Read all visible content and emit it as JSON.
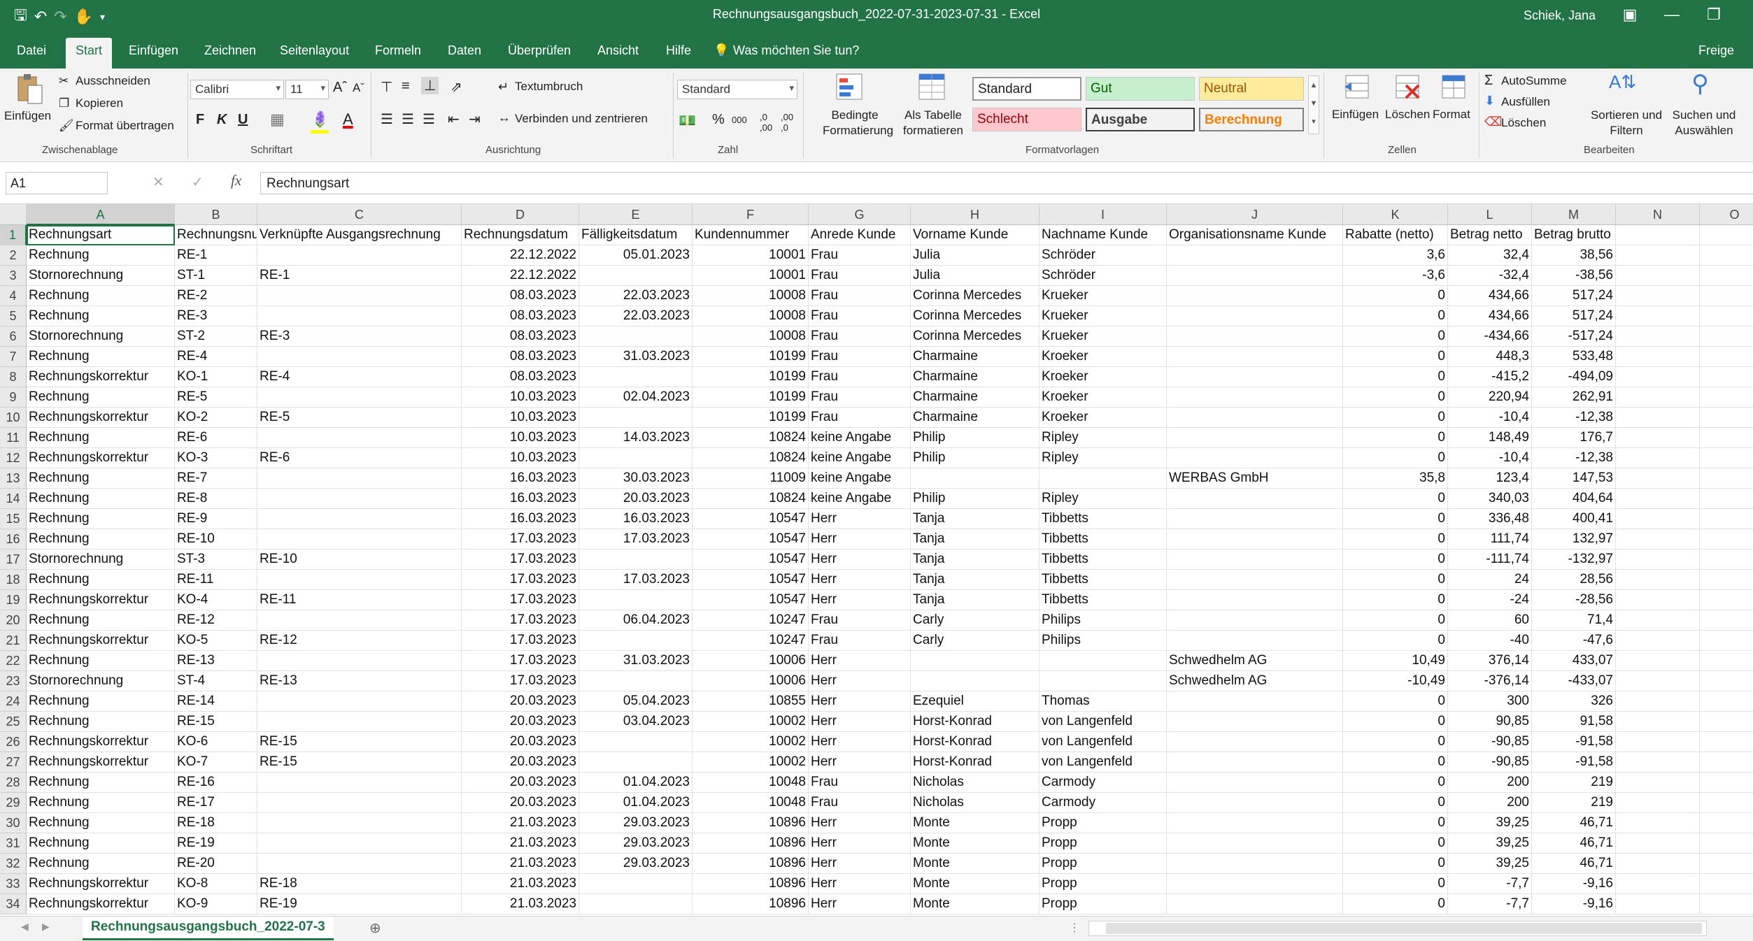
{
  "window": {
    "title": "Rechnungsausgangsbuch_2022-07-31-2023-07-31  -  Excel",
    "user": "Schiek, Jana"
  },
  "tabs": [
    "Datei",
    "Start",
    "Einfügen",
    "Zeichnen",
    "Seitenlayout",
    "Formeln",
    "Daten",
    "Überprüfen",
    "Ansicht",
    "Hilfe"
  ],
  "tell_me": "Was möchten Sie tun?",
  "share": "Freige",
  "ribbon": {
    "clipboard": {
      "paste": "Einfügen",
      "cut": "Ausschneiden",
      "copy": "Kopieren",
      "format_painter": "Format übertragen",
      "label": "Zwischenablage"
    },
    "font": {
      "name": "Calibri",
      "size": "11",
      "label": "Schriftart",
      "bold": "F",
      "italic": "K",
      "underline": "U"
    },
    "alignment": {
      "wrap": "Textumbruch",
      "merge": "Verbinden und zentrieren",
      "label": "Ausrichtung"
    },
    "number": {
      "format": "Standard",
      "label": "Zahl"
    },
    "styles": {
      "conditional": "Bedingte Formatierung",
      "as_table": "Als Tabelle formatieren",
      "standard": "Standard",
      "gut": "Gut",
      "neutral": "Neutral",
      "schlecht": "Schlecht",
      "ausgabe": "Ausgabe",
      "berechnung": "Berechnung",
      "label": "Formatvorlagen"
    },
    "cells": {
      "insert": "Einfügen",
      "delete": "Löschen",
      "format": "Format",
      "label": "Zellen"
    },
    "editing": {
      "autosum": "AutoSumme",
      "fill": "Ausfüllen",
      "clear": "Löschen",
      "sort": "Sortieren und Filtern",
      "find": "Suchen und Auswählen",
      "label": "Bearbeiten"
    }
  },
  "formula_bar": {
    "name_box": "A1",
    "content": "Rechnungsart"
  },
  "columns": [
    "A",
    "B",
    "C",
    "D",
    "E",
    "F",
    "G",
    "H",
    "I",
    "J",
    "K",
    "L",
    "M",
    "N",
    "O"
  ],
  "header_row": [
    "Rechnungsart",
    "Rechnungsnu",
    "Verknüpfte Ausgangsrechnung",
    "Rechnungsdatum",
    "Fälligkeitsdatum",
    "Kundennummer",
    "Anrede Kunde",
    "Vorname Kunde",
    "Nachname Kunde",
    "Organisationsname Kunde",
    "Rabatte (netto)",
    "Betrag netto",
    "Betrag brutto",
    "",
    ""
  ],
  "rows": [
    [
      "Rechnung",
      "RE-1",
      "",
      "22.12.2022",
      "05.01.2023",
      "10001",
      "Frau",
      "Julia",
      "Schröder",
      "",
      "3,6",
      "32,4",
      "38,56"
    ],
    [
      "Stornorechnung",
      "ST-1",
      "RE-1",
      "22.12.2022",
      "",
      "10001",
      "Frau",
      "Julia",
      "Schröder",
      "",
      "-3,6",
      "-32,4",
      "-38,56"
    ],
    [
      "Rechnung",
      "RE-2",
      "",
      "08.03.2023",
      "22.03.2023",
      "10008",
      "Frau",
      "Corinna Mercedes",
      "Krueker",
      "",
      "0",
      "434,66",
      "517,24"
    ],
    [
      "Rechnung",
      "RE-3",
      "",
      "08.03.2023",
      "22.03.2023",
      "10008",
      "Frau",
      "Corinna Mercedes",
      "Krueker",
      "",
      "0",
      "434,66",
      "517,24"
    ],
    [
      "Stornorechnung",
      "ST-2",
      "RE-3",
      "08.03.2023",
      "",
      "10008",
      "Frau",
      "Corinna Mercedes",
      "Krueker",
      "",
      "0",
      "-434,66",
      "-517,24"
    ],
    [
      "Rechnung",
      "RE-4",
      "",
      "08.03.2023",
      "31.03.2023",
      "10199",
      "Frau",
      "Charmaine",
      "Kroeker",
      "",
      "0",
      "448,3",
      "533,48"
    ],
    [
      "Rechnungskorrektur",
      "KO-1",
      "RE-4",
      "08.03.2023",
      "",
      "10199",
      "Frau",
      "Charmaine",
      "Kroeker",
      "",
      "0",
      "-415,2",
      "-494,09"
    ],
    [
      "Rechnung",
      "RE-5",
      "",
      "10.03.2023",
      "02.04.2023",
      "10199",
      "Frau",
      "Charmaine",
      "Kroeker",
      "",
      "0",
      "220,94",
      "262,91"
    ],
    [
      "Rechnungskorrektur",
      "KO-2",
      "RE-5",
      "10.03.2023",
      "",
      "10199",
      "Frau",
      "Charmaine",
      "Kroeker",
      "",
      "0",
      "-10,4",
      "-12,38"
    ],
    [
      "Rechnung",
      "RE-6",
      "",
      "10.03.2023",
      "14.03.2023",
      "10824",
      "keine Angabe",
      "Philip",
      "Ripley",
      "",
      "0",
      "148,49",
      "176,7"
    ],
    [
      "Rechnungskorrektur",
      "KO-3",
      "RE-6",
      "10.03.2023",
      "",
      "10824",
      "keine Angabe",
      "Philip",
      "Ripley",
      "",
      "0",
      "-10,4",
      "-12,38"
    ],
    [
      "Rechnung",
      "RE-7",
      "",
      "16.03.2023",
      "30.03.2023",
      "11009",
      "keine Angabe",
      "",
      "",
      "WERBAS GmbH",
      "35,8",
      "123,4",
      "147,53"
    ],
    [
      "Rechnung",
      "RE-8",
      "",
      "16.03.2023",
      "20.03.2023",
      "10824",
      "keine Angabe",
      "Philip",
      "Ripley",
      "",
      "0",
      "340,03",
      "404,64"
    ],
    [
      "Rechnung",
      "RE-9",
      "",
      "16.03.2023",
      "16.03.2023",
      "10547",
      "Herr",
      "Tanja",
      "Tibbetts",
      "",
      "0",
      "336,48",
      "400,41"
    ],
    [
      "Rechnung",
      "RE-10",
      "",
      "17.03.2023",
      "17.03.2023",
      "10547",
      "Herr",
      "Tanja",
      "Tibbetts",
      "",
      "0",
      "111,74",
      "132,97"
    ],
    [
      "Stornorechnung",
      "ST-3",
      "RE-10",
      "17.03.2023",
      "",
      "10547",
      "Herr",
      "Tanja",
      "Tibbetts",
      "",
      "0",
      "-111,74",
      "-132,97"
    ],
    [
      "Rechnung",
      "RE-11",
      "",
      "17.03.2023",
      "17.03.2023",
      "10547",
      "Herr",
      "Tanja",
      "Tibbetts",
      "",
      "0",
      "24",
      "28,56"
    ],
    [
      "Rechnungskorrektur",
      "KO-4",
      "RE-11",
      "17.03.2023",
      "",
      "10547",
      "Herr",
      "Tanja",
      "Tibbetts",
      "",
      "0",
      "-24",
      "-28,56"
    ],
    [
      "Rechnung",
      "RE-12",
      "",
      "17.03.2023",
      "06.04.2023",
      "10247",
      "Frau",
      "Carly",
      "Philips",
      "",
      "0",
      "60",
      "71,4"
    ],
    [
      "Rechnungskorrektur",
      "KO-5",
      "RE-12",
      "17.03.2023",
      "",
      "10247",
      "Frau",
      "Carly",
      "Philips",
      "",
      "0",
      "-40",
      "-47,6"
    ],
    [
      "Rechnung",
      "RE-13",
      "",
      "17.03.2023",
      "31.03.2023",
      "10006",
      "Herr",
      "",
      "",
      "Schwedhelm AG",
      "10,49",
      "376,14",
      "433,07"
    ],
    [
      "Stornorechnung",
      "ST-4",
      "RE-13",
      "17.03.2023",
      "",
      "10006",
      "Herr",
      "",
      "",
      "Schwedhelm AG",
      "-10,49",
      "-376,14",
      "-433,07"
    ],
    [
      "Rechnung",
      "RE-14",
      "",
      "20.03.2023",
      "05.04.2023",
      "10855",
      "Herr",
      "Ezequiel",
      "Thomas",
      "",
      "0",
      "300",
      "326"
    ],
    [
      "Rechnung",
      "RE-15",
      "",
      "20.03.2023",
      "03.04.2023",
      "10002",
      "Herr",
      "Horst-Konrad",
      "von Langenfeld",
      "",
      "0",
      "90,85",
      "91,58"
    ],
    [
      "Rechnungskorrektur",
      "KO-6",
      "RE-15",
      "20.03.2023",
      "",
      "10002",
      "Herr",
      "Horst-Konrad",
      "von Langenfeld",
      "",
      "0",
      "-90,85",
      "-91,58"
    ],
    [
      "Rechnungskorrektur",
      "KO-7",
      "RE-15",
      "20.03.2023",
      "",
      "10002",
      "Herr",
      "Horst-Konrad",
      "von Langenfeld",
      "",
      "0",
      "-90,85",
      "-91,58"
    ],
    [
      "Rechnung",
      "RE-16",
      "",
      "20.03.2023",
      "01.04.2023",
      "10048",
      "Frau",
      "Nicholas",
      "Carmody",
      "",
      "0",
      "200",
      "219"
    ],
    [
      "Rechnung",
      "RE-17",
      "",
      "20.03.2023",
      "01.04.2023",
      "10048",
      "Frau",
      "Nicholas",
      "Carmody",
      "",
      "0",
      "200",
      "219"
    ],
    [
      "Rechnung",
      "RE-18",
      "",
      "21.03.2023",
      "29.03.2023",
      "10896",
      "Herr",
      "Monte",
      "Propp",
      "",
      "0",
      "39,25",
      "46,71"
    ],
    [
      "Rechnung",
      "RE-19",
      "",
      "21.03.2023",
      "29.03.2023",
      "10896",
      "Herr",
      "Monte",
      "Propp",
      "",
      "0",
      "39,25",
      "46,71"
    ],
    [
      "Rechnung",
      "RE-20",
      "",
      "21.03.2023",
      "29.03.2023",
      "10896",
      "Herr",
      "Monte",
      "Propp",
      "",
      "0",
      "39,25",
      "46,71"
    ],
    [
      "Rechnungskorrektur",
      "KO-8",
      "RE-18",
      "21.03.2023",
      "",
      "10896",
      "Herr",
      "Monte",
      "Propp",
      "",
      "0",
      "-7,7",
      "-9,16"
    ],
    [
      "Rechnungskorrektur",
      "KO-9",
      "RE-19",
      "21.03.2023",
      "",
      "10896",
      "Herr",
      "Monte",
      "Propp",
      "",
      "0",
      "-7,7",
      "-9,16"
    ]
  ],
  "sheet_tab": "Rechnungsausgangsbuch_2022-07-3",
  "colors": {
    "accent": "#217346"
  }
}
